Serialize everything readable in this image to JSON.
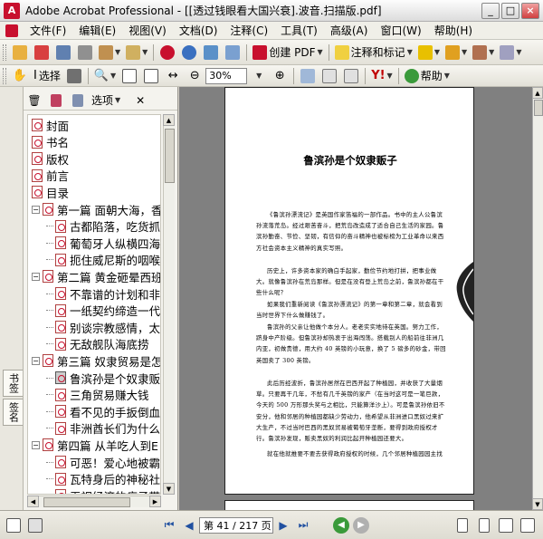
{
  "titlebar": {
    "title": "Adobe Acrobat Professional - [[透过钱眼看大国兴衰].波音.扫描版.pdf]",
    "app_icon": "acrobat-icon",
    "buttons": {
      "minimize": "_",
      "maximize": "□",
      "close": "×"
    }
  },
  "menubar": {
    "items": [
      "文件(F)",
      "编辑(E)",
      "视图(V)",
      "文档(D)",
      "注释(C)",
      "工具(T)",
      "高级(A)",
      "窗口(W)",
      "帮助(H)"
    ]
  },
  "toolbar1": {
    "create_pdf": "创建 PDF",
    "comment_markup": "注释和标记"
  },
  "toolbar2": {
    "select": "选择",
    "zoom_value": "30%",
    "help": "帮助"
  },
  "sidebar": {
    "tabs": [
      "书签",
      "签名"
    ],
    "options_label": "选项",
    "bookmarks": [
      {
        "label": "封面",
        "level": 0,
        "toggle": ""
      },
      {
        "label": "书名",
        "level": 0,
        "toggle": ""
      },
      {
        "label": "版权",
        "level": 0,
        "toggle": ""
      },
      {
        "label": "前言",
        "level": 0,
        "toggle": ""
      },
      {
        "label": "目录",
        "level": 0,
        "toggle": ""
      },
      {
        "label": "第一篇 面朝大海，香",
        "level": 0,
        "toggle": "−"
      },
      {
        "label": "古都陷落，吃货抓",
        "level": 1,
        "toggle": ""
      },
      {
        "label": "葡萄牙人纵横四海",
        "level": 1,
        "toggle": ""
      },
      {
        "label": "扼住威尼斯的咽喉",
        "level": 1,
        "toggle": ""
      },
      {
        "label": "第二篇 黄金砸晕西班",
        "level": 0,
        "toggle": "−"
      },
      {
        "label": "不靠谱的计划和非",
        "level": 1,
        "toggle": ""
      },
      {
        "label": "一纸契约缔造一代",
        "level": 1,
        "toggle": ""
      },
      {
        "label": "别谈宗教感情，太",
        "level": 1,
        "toggle": ""
      },
      {
        "label": "无敌舰队海底捞",
        "level": 1,
        "toggle": ""
      },
      {
        "label": "第三篇 奴隶贸易是怎",
        "level": 0,
        "toggle": "−"
      },
      {
        "label": "鲁滨孙是个奴隶贩",
        "level": 1,
        "toggle": "",
        "selected": true
      },
      {
        "label": "三角贸易赚大钱",
        "level": 1,
        "toggle": ""
      },
      {
        "label": "看不见的手扳倒血",
        "level": 1,
        "toggle": ""
      },
      {
        "label": "非洲酋长们为什么",
        "level": 1,
        "toggle": ""
      },
      {
        "label": "第四篇 从羊吃人到E",
        "level": 0,
        "toggle": "−"
      },
      {
        "label": "可恶！爱心地被霸",
        "level": 1,
        "toggle": ""
      },
      {
        "label": "瓦特身后的神秘社",
        "level": 1,
        "toggle": ""
      },
      {
        "label": "无视经济的疯子带",
        "level": 1,
        "toggle": ""
      }
    ]
  },
  "document": {
    "page_title": "鲁滨孙是个奴隶贩子",
    "paragraphs": [
      "《鲁滨孙漂流记》是英国作家笛福的一部作品。书中的主人公鲁滨孙流落荒岛。经过艰苦奋斗，把荒岛改造成了适合自己生活的家园。鲁滨孙勤奋、节俭、坚韧，有信仰的奋斗精神也被标榜为工业革命以来西方社会资本主义精神的真实写照。",
      "历史上，许多资本家的确白手起家，勤俭节约地打拼，把事业做大。就像鲁滨孙在荒岛那样。但是在没有登上荒岛之前，鲁滨孙都在干些什么呢？",
      "如果我们重新阅读《鲁滨孙漂流记》的第一章和第二章，就会看到当时世界下什么做赚钱了。",
      "鲁滨孙的父亲让他做个本分人。老老实实地待在英国。努力工作，跻身中产阶级。但鲁滨孙却热衷于出海闯荡。搭载别人的船前往非洲几内亚，初做贵德，用大约 40 英镑的小玩意，换了 5 磅多的砂金，带回英国卖了 300 英镑。",
      "此后历经波折，鲁滨孙居然在巴西开起了种植园，并收获了大量烟草。只要再干几年，不愁有几千英镑的家产（在当时这可是一笔巨款，今天的 500 万形那头奖与之相比，只能算洋沙上）。可是鲁滨孙依旧不安分，他和邻居的种植园都缺少劳动力，他希望从非洲进口黑奴过来扩大生产，不过当时巴西的黑奴贸易被葡萄牙垄断，要得到政府授权才行。鲁滨孙发现，贩卖黑奴的利润比起开种植园还要大。",
      "就在他就推要不要去获得政府授权的时候，几个邻居种植园园主找"
    ]
  },
  "statusbar": {
    "page_display": "第 41 / 217 页"
  },
  "colors": {
    "acrobat_red": "#c8102e",
    "doc_background": "#808080",
    "nav_green": "#3a9a3a"
  }
}
